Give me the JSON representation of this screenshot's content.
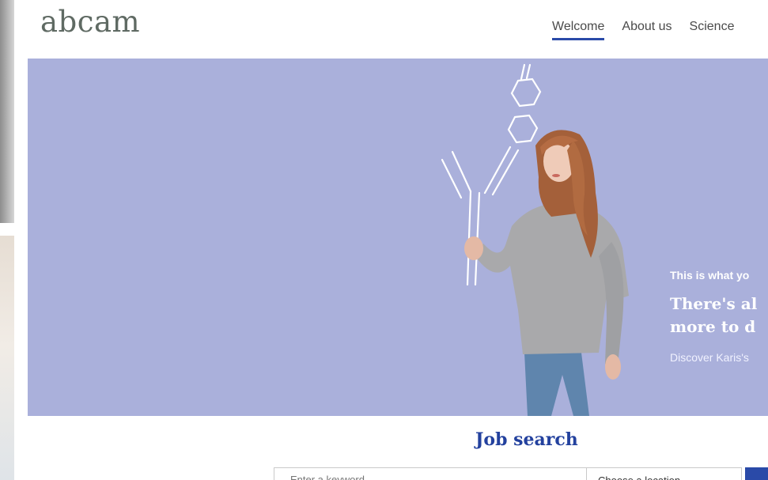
{
  "brand": {
    "logo_text": "abcam"
  },
  "nav": {
    "items": [
      {
        "label": "Welcome",
        "active": true
      },
      {
        "label": "About us",
        "active": false
      },
      {
        "label": "Science",
        "active": false
      }
    ]
  },
  "hero": {
    "kicker": "This is what yo",
    "headline_line1": "There's al",
    "headline_line2": "more to d",
    "link": "Discover Karis's",
    "background_color": "#aab0db"
  },
  "job_search": {
    "title": "Job search",
    "keyword_placeholder": "Enter a keyword",
    "location_value": "Choose a location"
  },
  "colors": {
    "accent": "#2a4aa8",
    "logo": "#5f6a63"
  }
}
